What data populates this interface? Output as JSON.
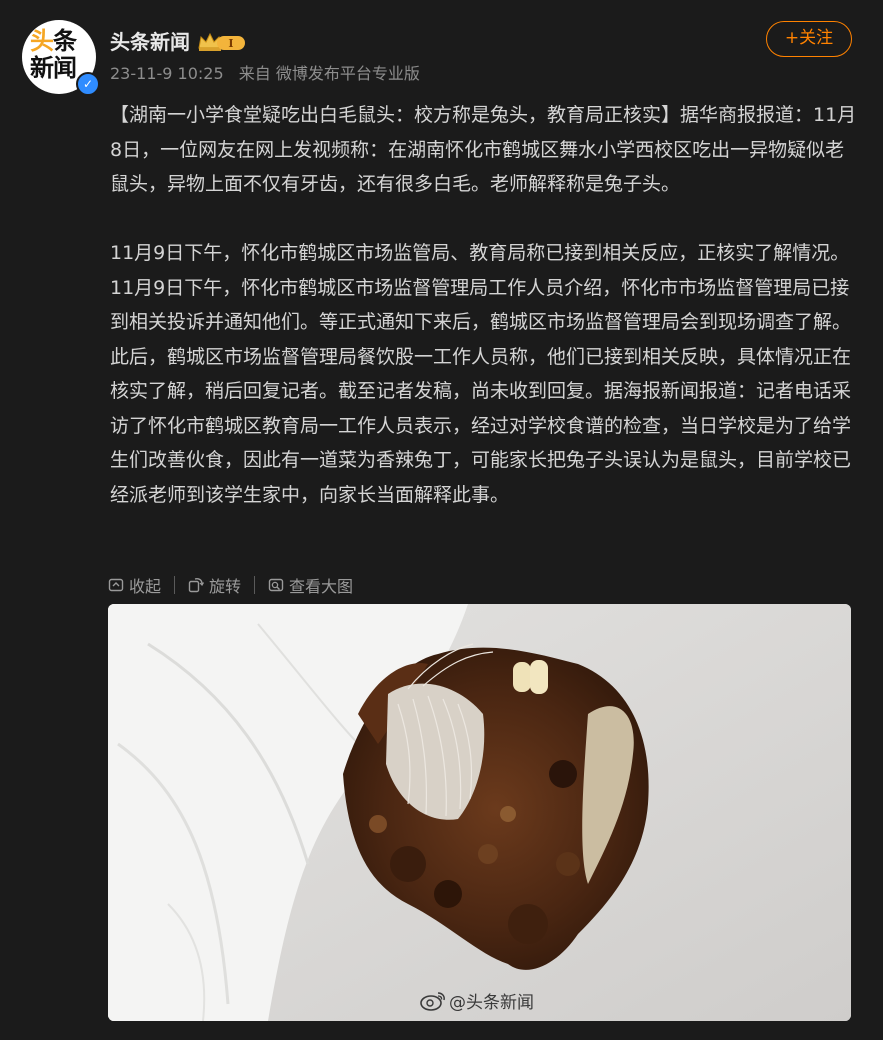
{
  "header": {
    "avatar_line1_accent": "头",
    "avatar_line1_rest": "条",
    "avatar_line2": "新闻",
    "username": "头条新闻",
    "crown_level": "I",
    "timestamp": "23-11-9 10:25",
    "source": "来自 微博发布平台专业版",
    "follow_label": "+关注"
  },
  "post": {
    "paragraphs": [
      "【湖南一小学食堂疑吃出白毛鼠头：校方称是兔头，教育局正核实】据华商报报道：11月8日，一位网友在网上发视频称：在湖南怀化市鹤城区舞水小学西校区吃出一异物疑似老鼠头，异物上面不仅有牙齿，还有很多白毛。老师解释称是兔子头。",
      "11月9日下午，怀化市鹤城区市场监管局、教育局称已接到相关反应，正核实了解情况。11月9日下午，怀化市鹤城区市场监督管理局工作人员介绍，怀化市市场监督管理局已接到相关投诉并通知他们。等正式通知下来后，鹤城区市场监督管理局会到现场调查了解。此后，鹤城区市场监督管理局餐饮股一工作人员称，他们已接到相关反映，具体情况正在核实了解，稍后回复记者。截至记者发稿，尚未收到回复。据海报新闻报道：记者电话采访了怀化市鹤城区教育局一工作人员表示，经过对学校食谱的检查，当日学校是为了给学生们改善伙食，因此有一道菜为香辣兔丁，可能家长把兔子头误认为是鼠头，目前学校已经派老师到该学生家中，向家长当面解释此事。"
    ]
  },
  "image_toolbar": {
    "collapse_label": "收起",
    "rotate_label": "旋转",
    "view_large_label": "查看大图"
  },
  "photo": {
    "watermark": "@头条新闻"
  },
  "colors": {
    "background": "#1b1b1b",
    "accent_orange": "#ff8200",
    "verify_blue": "#2f8cff",
    "text": "#d4d4d4",
    "muted": "#8d8d8d"
  }
}
